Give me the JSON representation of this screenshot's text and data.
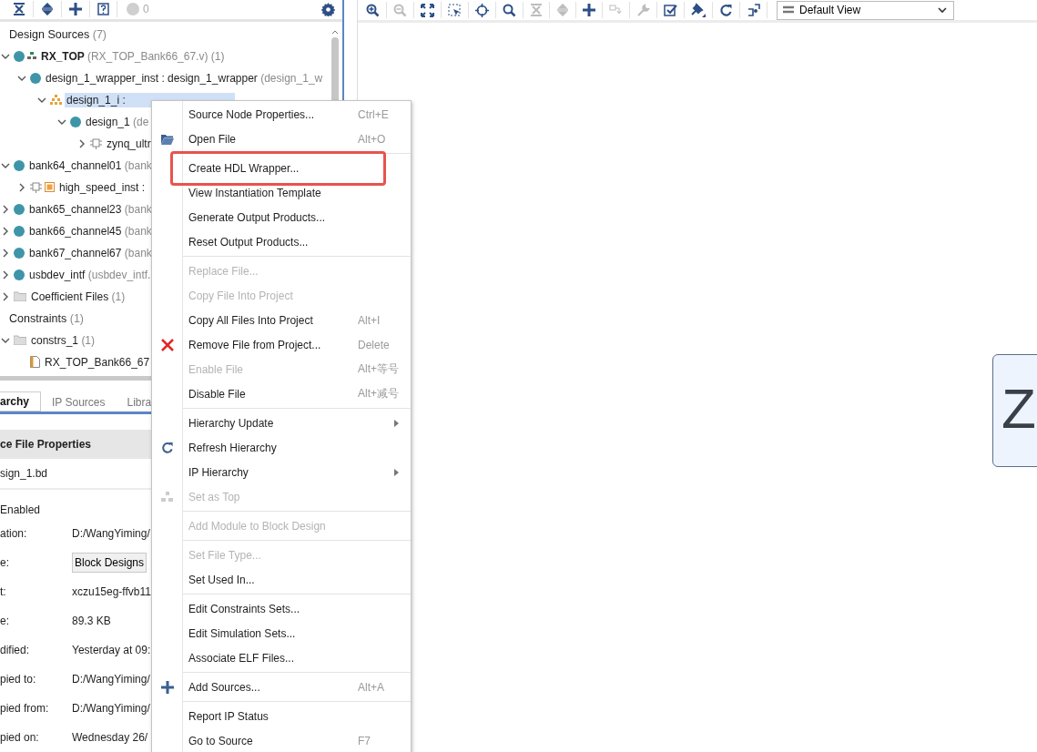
{
  "left_toolbar": {
    "buttons": [
      {
        "kind": "collapse-all",
        "disabled": false
      },
      {
        "kind": "expand-all",
        "disabled": false
      },
      {
        "kind": "plus",
        "disabled": false
      },
      {
        "kind": "help",
        "disabled": false
      }
    ],
    "status_count": "0"
  },
  "tree": [
    {
      "name": "Design Sources",
      "detail": "(7)",
      "kind": "group",
      "selected": false,
      "children": [
        {
          "name": "RX_TOP",
          "detail": "(RX_TOP_Bank66_67.v) (1)",
          "kind": "top",
          "expanded": true,
          "selected": false,
          "children": [
            {
              "name": "design_1_wrapper_inst : design_1_wrapper",
              "detail": "(design_1_w",
              "kind": "module",
              "expanded": true,
              "selected": false,
              "children": [
                {
                  "name": "design_1_i :",
                  "kind": "block-design",
                  "expanded": true,
                  "selected": true,
                  "children": [
                    {
                      "name": "design_1",
                      "detail": "(de",
                      "kind": "module",
                      "expanded": true,
                      "selected": false,
                      "children": [
                        {
                          "name": "zynq_ultr",
                          "kind": "chip",
                          "expanded": false,
                          "selected": false
                        }
                      ]
                    }
                  ]
                }
              ]
            }
          ]
        },
        {
          "name": "bank64_channel01",
          "detail": "(bank",
          "kind": "module",
          "expanded": true,
          "selected": false,
          "children": [
            {
              "name": "high_speed_inst :",
              "kind": "ip",
              "expanded": false,
              "selected": false
            }
          ]
        },
        {
          "name": "bank65_channel23",
          "detail": "(bank",
          "kind": "module",
          "expanded": false,
          "selected": false
        },
        {
          "name": "bank66_channel45",
          "detail": "(bank",
          "kind": "module",
          "expanded": false,
          "selected": false
        },
        {
          "name": "bank67_channel67",
          "detail": "(bank",
          "kind": "module",
          "expanded": false,
          "selected": false
        },
        {
          "name": "usbdev_intf",
          "detail": "(usbdev_intf.",
          "kind": "module",
          "expanded": false,
          "selected": false
        },
        {
          "name": "Coefficient Files",
          "detail": "(1)",
          "kind": "folder",
          "expanded": false,
          "selected": false
        }
      ]
    },
    {
      "name": "Constraints",
      "detail": "(1)",
      "kind": "group",
      "selected": false,
      "children": [
        {
          "name": "constrs_1",
          "detail": "(1)",
          "kind": "folder",
          "expanded": true,
          "selected": false,
          "children": [
            {
              "name": "RX_TOP_Bank66_67",
              "kind": "file",
              "selected": false
            }
          ]
        }
      ]
    }
  ],
  "tabs": [
    {
      "label": "archy",
      "selected": true
    },
    {
      "label": "IP Sources",
      "selected": false
    },
    {
      "label": "Libra",
      "selected": false
    }
  ],
  "properties": {
    "title": "ce File Properties",
    "file_name": "sign_1.bd",
    "enabled_label": "Enabled",
    "rows": [
      {
        "label": "ation:",
        "value": "D:/WangYiming/",
        "kind": "text"
      },
      {
        "label": "e:",
        "value": "Block Designs",
        "kind": "button"
      },
      {
        "label": "t:",
        "value": "xczu15eg-ffvb11",
        "kind": "text"
      },
      {
        "label": "e:",
        "value": "89.3 KB",
        "kind": "text"
      },
      {
        "label": "dified:",
        "value": "Yesterday at 09:",
        "kind": "text"
      },
      {
        "label": "pied to:",
        "value": "D:/WangYiming/",
        "kind": "text"
      },
      {
        "label": "pied from:",
        "value": "D:/WangYiming/",
        "kind": "text"
      },
      {
        "label": "pied on:",
        "value": "Wednesday 26/",
        "kind": "text"
      }
    ]
  },
  "right_toolbar": {
    "buttons": [
      {
        "kind": "zoom-in",
        "disabled": false
      },
      {
        "kind": "zoom-out",
        "disabled": true
      },
      {
        "kind": "fit",
        "disabled": false
      },
      {
        "kind": "select-area",
        "disabled": false
      },
      {
        "kind": "crosshair",
        "disabled": false
      },
      {
        "kind": "search",
        "disabled": false
      },
      {
        "kind": "collapse-all",
        "disabled": true
      },
      {
        "kind": "expand-all",
        "disabled": true
      },
      {
        "kind": "plus",
        "disabled": false
      },
      {
        "kind": "connect",
        "disabled": true
      },
      {
        "kind": "wrench",
        "disabled": true
      },
      {
        "kind": "check",
        "disabled": false
      },
      {
        "kind": "pin",
        "disabled": false
      },
      {
        "kind": "refresh",
        "disabled": false
      },
      {
        "kind": "route",
        "disabled": false
      }
    ],
    "view": "Default View"
  },
  "canvas": {
    "block_label": "Z"
  },
  "context_menu": [
    {
      "kind": "item",
      "label": "Source Node Properties...",
      "shortcut": "Ctrl+E",
      "disabled": false,
      "submenu": false,
      "outlined": false
    },
    {
      "kind": "folder",
      "label": "Open File",
      "shortcut": "Alt+O",
      "disabled": false,
      "submenu": false,
      "outlined": false
    },
    {
      "kind": "separator"
    },
    {
      "kind": "item",
      "label": "Create HDL Wrapper...",
      "disabled": false,
      "submenu": false,
      "outlined": true
    },
    {
      "kind": "item",
      "label": "View Instantiation Template",
      "disabled": false,
      "submenu": false,
      "outlined": false
    },
    {
      "kind": "item",
      "label": "Generate Output Products...",
      "disabled": false,
      "submenu": false,
      "outlined": false
    },
    {
      "kind": "item",
      "label": "Reset Output Products...",
      "disabled": false,
      "submenu": false,
      "outlined": false
    },
    {
      "kind": "separator"
    },
    {
      "kind": "item",
      "label": "Replace File...",
      "disabled": true,
      "submenu": false,
      "outlined": false
    },
    {
      "kind": "item",
      "label": "Copy File Into Project",
      "disabled": true,
      "submenu": false,
      "outlined": false
    },
    {
      "kind": "item",
      "label": "Copy All Files Into Project",
      "shortcut": "Alt+I",
      "disabled": false,
      "submenu": false,
      "outlined": false
    },
    {
      "kind": "remove",
      "label": "Remove File from Project...",
      "shortcut": "Delete",
      "disabled": false,
      "submenu": false,
      "outlined": false
    },
    {
      "kind": "item",
      "label": "Enable File",
      "shortcut": "Alt+等号",
      "disabled": true,
      "submenu": false,
      "outlined": false
    },
    {
      "kind": "item",
      "label": "Disable File",
      "shortcut": "Alt+减号",
      "disabled": false,
      "submenu": false,
      "outlined": false
    },
    {
      "kind": "separator"
    },
    {
      "kind": "item",
      "label": "Hierarchy Update",
      "disabled": false,
      "submenu": true,
      "outlined": false
    },
    {
      "kind": "refresh",
      "label": "Refresh Hierarchy",
      "disabled": false,
      "submenu": false,
      "outlined": false
    },
    {
      "kind": "item",
      "label": "IP Hierarchy",
      "disabled": false,
      "submenu": true,
      "outlined": false
    },
    {
      "kind": "top",
      "label": "Set as Top",
      "disabled": true,
      "submenu": false,
      "outlined": false
    },
    {
      "kind": "separator"
    },
    {
      "kind": "item",
      "label": "Add Module to Block Design",
      "disabled": true,
      "submenu": false,
      "outlined": false
    },
    {
      "kind": "separator"
    },
    {
      "kind": "item",
      "label": "Set File Type...",
      "disabled": true,
      "submenu": false,
      "outlined": false
    },
    {
      "kind": "item",
      "label": "Set Used In...",
      "disabled": false,
      "submenu": false,
      "outlined": false
    },
    {
      "kind": "separator"
    },
    {
      "kind": "item",
      "label": "Edit Constraints Sets...",
      "disabled": false,
      "submenu": false,
      "outlined": false
    },
    {
      "kind": "item",
      "label": "Edit Simulation Sets...",
      "disabled": false,
      "submenu": false,
      "outlined": false
    },
    {
      "kind": "item",
      "label": "Associate ELF Files...",
      "disabled": false,
      "submenu": false,
      "outlined": false
    },
    {
      "kind": "separator"
    },
    {
      "kind": "add",
      "label": "Add Sources...",
      "shortcut": "Alt+A",
      "disabled": false,
      "submenu": false,
      "outlined": false
    },
    {
      "kind": "separator"
    },
    {
      "kind": "item",
      "label": "Report IP Status",
      "disabled": false,
      "submenu": false,
      "outlined": false
    },
    {
      "kind": "item",
      "label": "Go to Source",
      "shortcut": "F7",
      "disabled": false,
      "submenu": false,
      "outlined": false
    }
  ]
}
